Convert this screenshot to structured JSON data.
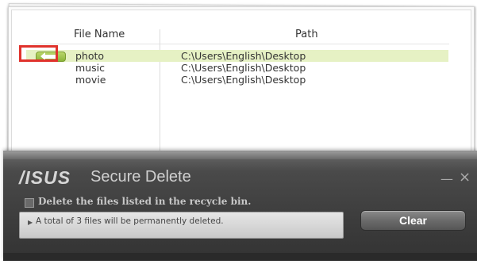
{
  "list": {
    "columns": {
      "name": "File Name",
      "path": "Path"
    },
    "rows": [
      {
        "name": "photo",
        "path": "C:\\Users\\English\\Desktop",
        "selected": true
      },
      {
        "name": "music",
        "path": "C:\\Users\\English\\Desktop",
        "selected": false
      },
      {
        "name": "movie",
        "path": "C:\\Users\\English\\Desktop",
        "selected": false
      }
    ],
    "restore_icon": "arrow-left-icon",
    "highlight_color": "#e0322c",
    "selected_row_color": "#e6f1c4"
  },
  "panel": {
    "brand": "/ISUS",
    "title": "Secure Delete",
    "minimize_glyph": "—",
    "close_glyph": "×",
    "checkbox_label": "Delete the files listed in the recycle bin.",
    "checkbox_checked": false,
    "status_arrow_icon": "triangle-right-icon",
    "status_text": "A total of 3 files will be permanently deleted.",
    "clear_label": "Clear"
  }
}
